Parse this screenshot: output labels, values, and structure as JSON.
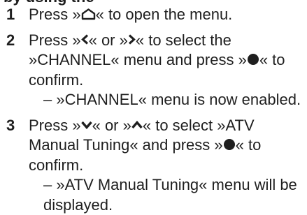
{
  "heading_partial": "by using the",
  "steps": [
    {
      "number": "1",
      "parts": [
        "Press »",
        "« to open the menu."
      ],
      "icons": [
        "home-icon"
      ]
    },
    {
      "number": "2",
      "parts": [
        "Press »",
        "« or »",
        "« to select the »CHANNEL« menu and press »",
        "« to confirm."
      ],
      "icons": [
        "left-arrow-icon",
        "right-arrow-icon",
        "ok-dot-icon"
      ],
      "sub": "– »CHANNEL« menu is now enabled."
    },
    {
      "number": "3",
      "parts": [
        "Press »",
        "« or »",
        "« to select »ATV Manual Tuning« and press »",
        "« to confirm."
      ],
      "icons": [
        "down-arrow-icon",
        "up-arrow-icon",
        "ok-dot-icon"
      ],
      "sub": "– »ATV Manual Tuning« menu will be displayed."
    }
  ]
}
